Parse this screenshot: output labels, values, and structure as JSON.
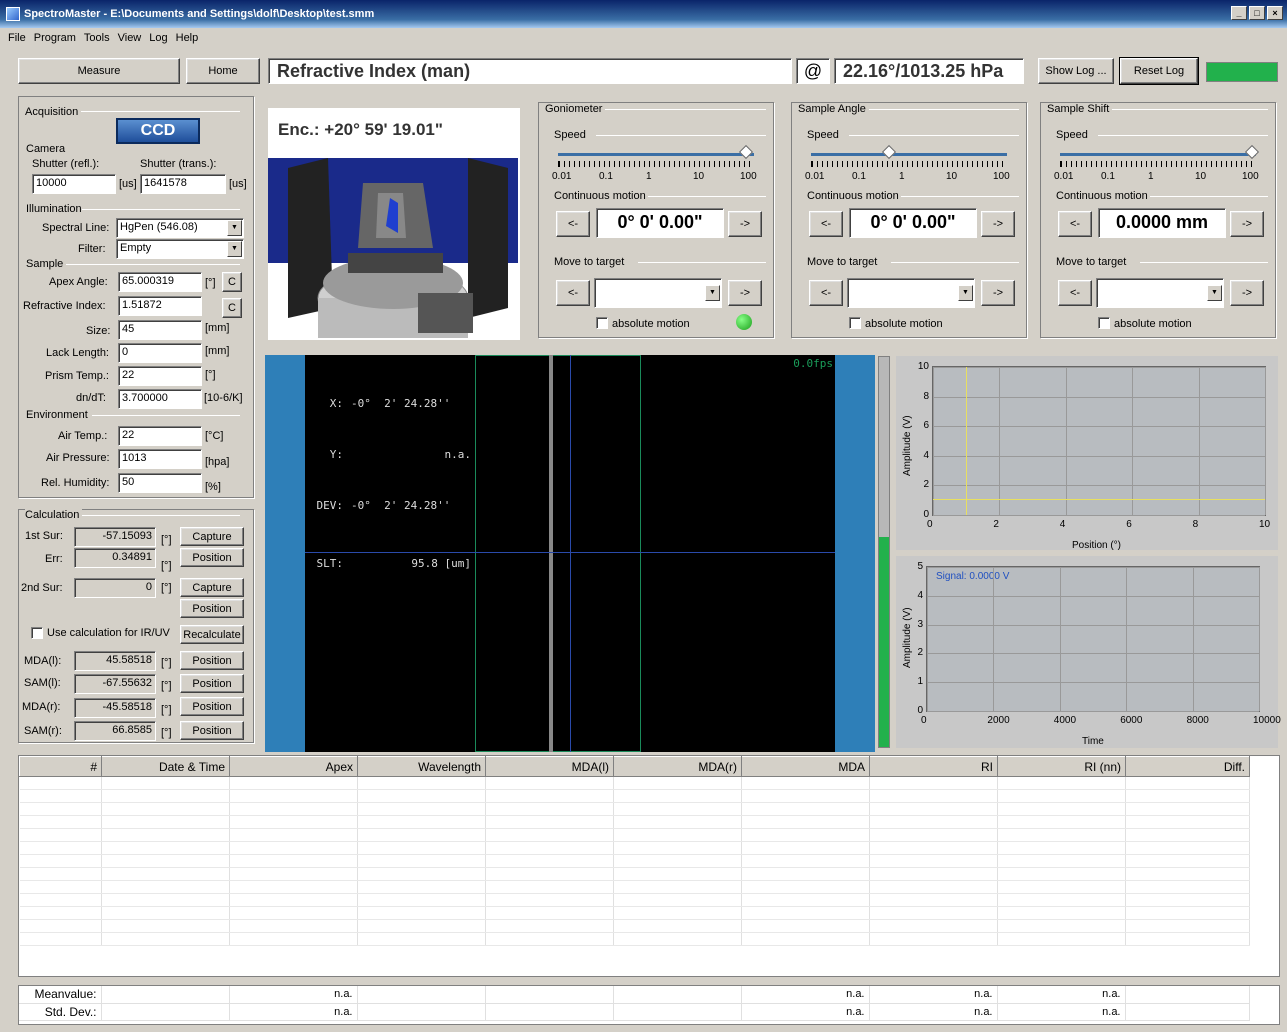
{
  "window": {
    "title": "SpectroMaster - E:\\Documents and Settings\\dolf\\Desktop\\test.smm",
    "controls": [
      "_",
      "□",
      "×"
    ]
  },
  "menu": [
    "File",
    "Program",
    "Tools",
    "View",
    "Log",
    "Help"
  ],
  "toolbar": {
    "measure": "Measure",
    "home": "Home",
    "mode": "Refractive Index (man)",
    "at": "@",
    "conditions": "22.16°/1013.25 hPa",
    "show_log": "Show Log ...",
    "reset_log": "Reset Log",
    "status_color": "#22b14c"
  },
  "acq": {
    "title": "Acquisition",
    "ccd": "CCD",
    "camera": "Camera",
    "shutter_refl_lbl": "Shutter (refl.):",
    "shutter_trans_lbl": "Shutter (trans.):",
    "shutter_refl": "10000",
    "shutter_trans": "1641578",
    "us": "[us]",
    "illumination": "Illumination",
    "spectral_lbl": "Spectral Line:",
    "spectral": "HgPen (546.08)",
    "filter_lbl": "Filter:",
    "filter": "Empty",
    "sample": "Sample",
    "apex_lbl": "Apex Angle:",
    "apex": "65.000319",
    "deg": "[°]",
    "c": "C",
    "ri_lbl": "Refractive Index:",
    "ri": "1.51872",
    "size_lbl": "Size:",
    "size": "45",
    "mm": "[mm]",
    "lack_lbl": "Lack Length:",
    "lack": "0",
    "prism_lbl": "Prism Temp.:",
    "prism": "22",
    "dndt_lbl": "dn/dT:",
    "dndt": "3.700000",
    "dndt_unit": "[10-6/K]",
    "environment": "Environment",
    "air_lbl": "Air Temp.:",
    "air": "22",
    "degc": "[°C]",
    "press_lbl": "Air Pressure:",
    "press": "1013",
    "hpa": "[hpa]",
    "hum_lbl": "Rel. Humidity:",
    "hum": "50",
    "pct": "[%]"
  },
  "calc": {
    "title": "Calculation",
    "s1_lbl": "1st Sur:",
    "s1": "-57.15093",
    "err_lbl": "Err:",
    "err": "0.34891",
    "s2_lbl": "2nd Sur:",
    "s2": "0",
    "deg": "[°]",
    "capture": "Capture",
    "position": "Position",
    "use_calc": "Use calculation for IR/UV",
    "recalc": "Recalculate",
    "mdal_lbl": "MDA(l):",
    "mdal": "45.58518",
    "saml_lbl": "SAM(l):",
    "saml": "-67.55632",
    "mdar_lbl": "MDA(r):",
    "mdar": "-45.58518",
    "samr_lbl": "SAM(r):",
    "samr": "66.8585"
  },
  "enc": {
    "label": "Enc.: +20° 59' 19.01\""
  },
  "motion": [
    {
      "title": "Goniometer",
      "speed": "Speed",
      "cont": "Continuous motion",
      "value": "0° 0' 0.00\"",
      "move": "Move to target",
      "abs": "absolute motion",
      "led": true,
      "thumb": 0.96
    },
    {
      "title": "Sample Angle",
      "speed": "Speed",
      "cont": "Continuous motion",
      "value": "0° 0' 0.00\"",
      "move": "Move to target",
      "abs": "absolute motion",
      "led": false,
      "thumb": 0.4
    },
    {
      "title": "Sample Shift",
      "speed": "Speed",
      "cont": "Continuous motion",
      "value": "0.0000 mm",
      "move": "Move to target",
      "abs": "absolute motion",
      "led": false,
      "thumb": 0.98
    }
  ],
  "scale_labels": [
    "0.01",
    "0.1",
    "1",
    "10",
    "100"
  ],
  "arrow_left": "<-",
  "arrow_right": "->",
  "cam": {
    "x_lbl": "X:",
    "x": "-0°  2' 24.28''",
    "y_lbl": "Y:",
    "y": "n.a.",
    "dev_lbl": "DEV:",
    "dev": "-0°  2' 24.28''",
    "slt_lbl": "SLT:",
    "slt": "95.8 [um]",
    "fps": "0.0fps"
  },
  "plot1": {
    "ylabel": "Amplitude (V)",
    "xlabel": "Position (°)",
    "yticks": [
      "10",
      "8",
      "6",
      "4",
      "2",
      "0"
    ],
    "xticks": [
      "0",
      "2",
      "4",
      "6",
      "8",
      "10"
    ]
  },
  "plot2": {
    "ylabel": "Amplitude (V)",
    "xlabel": "Time",
    "signal": "Signal: 0.0000 V",
    "yticks": [
      "5",
      "4",
      "3",
      "2",
      "1",
      "0"
    ],
    "xticks": [
      "0",
      "2000",
      "4000",
      "6000",
      "8000",
      "10000"
    ]
  },
  "table": {
    "headers": [
      "#",
      "Date & Time",
      "Apex",
      "Wavelength",
      "MDA(l)",
      "MDA(r)",
      "MDA",
      "RI",
      "RI (nn)",
      "Diff."
    ]
  },
  "stats": {
    "mean": "Meanvalue:",
    "std": "Std. Dev.:",
    "na": "n.a."
  }
}
